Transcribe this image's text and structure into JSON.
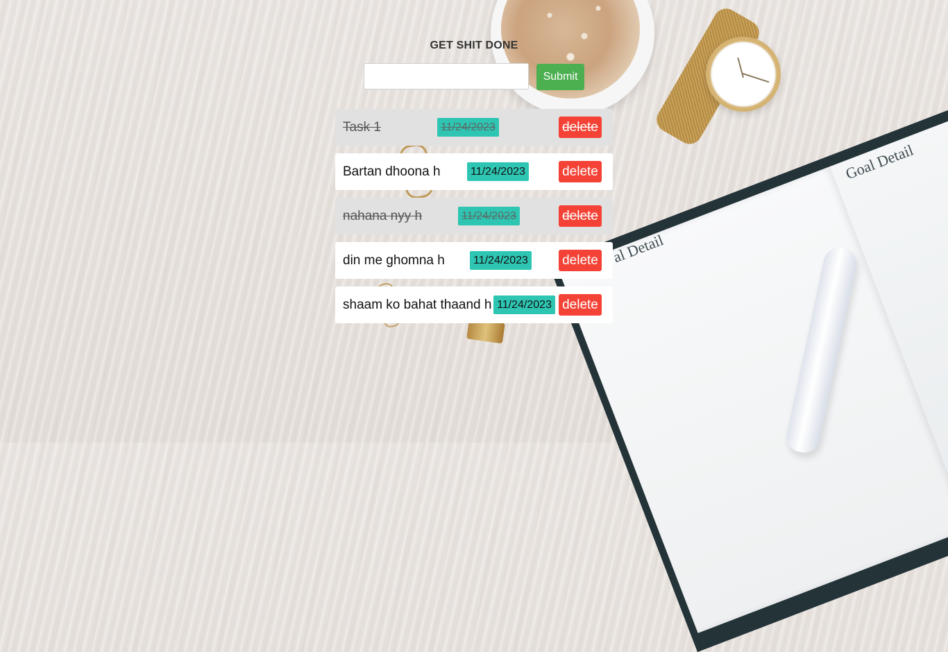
{
  "app": {
    "title": "GET SHIT DONE",
    "input": {
      "value": "",
      "placeholder": ""
    },
    "submit_label": "Submit"
  },
  "tasks": [
    {
      "text": "Task 1",
      "date": "11/24/2023",
      "delete_label": "delete",
      "completed": true
    },
    {
      "text": "Bartan dhoona h",
      "date": "11/24/2023",
      "delete_label": "delete",
      "completed": false
    },
    {
      "text": "nahana nyy h",
      "date": "11/24/2023",
      "delete_label": "delete",
      "completed": true
    },
    {
      "text": "din me ghomna h",
      "date": "11/24/2023",
      "delete_label": "delete",
      "completed": false
    },
    {
      "text": "shaam ko bahat thaand h",
      "date": "11/24/2023",
      "delete_label": "delete",
      "completed": false
    }
  ],
  "background": {
    "notebook_heading": "Goal Detail",
    "notebook_heading_partial": "al Detail"
  },
  "colors": {
    "submit": "#4caf50",
    "delete": "#f44336",
    "date_badge": "#2ec6b3",
    "completed_row": "#e2e1e1",
    "active_row": "#ffffff"
  }
}
